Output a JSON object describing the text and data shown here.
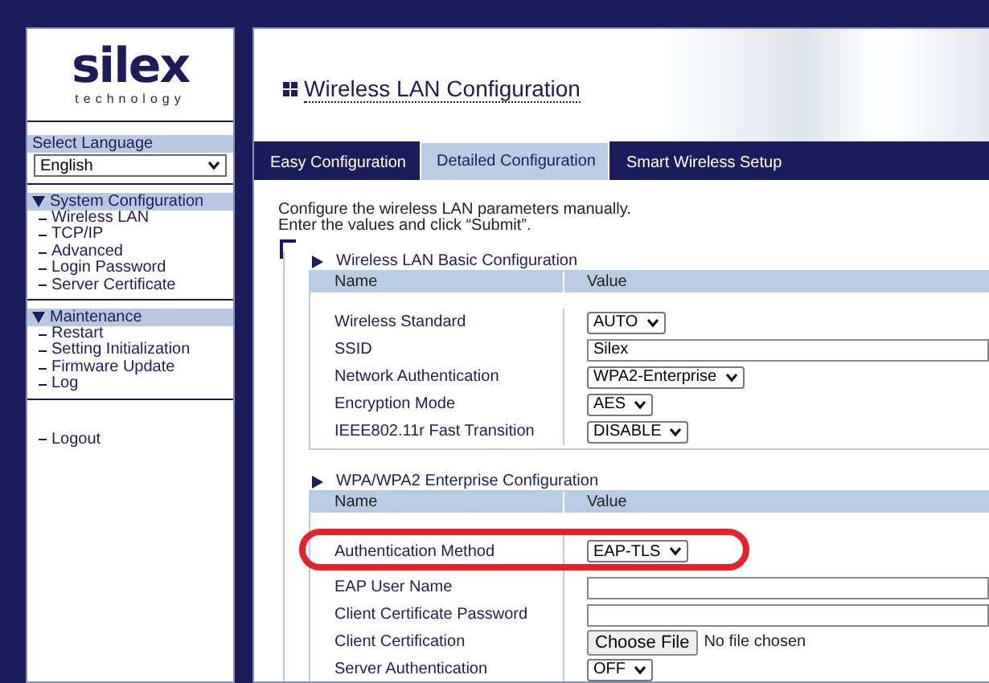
{
  "logo": {
    "name": "silex",
    "tagline": "technology"
  },
  "sidebar": {
    "language_label": "Select Language",
    "language": "English",
    "sections": [
      {
        "title": "System Configuration",
        "expanded": true,
        "items": [
          "Wireless LAN",
          "TCP/IP",
          "Advanced",
          "Login Password",
          "Server Certificate"
        ]
      },
      {
        "title": "Maintenance",
        "expanded": true,
        "items": [
          "Restart",
          "Setting Initialization",
          "Firmware Update",
          "Log"
        ]
      }
    ],
    "logout": "Logout"
  },
  "page_title": "Wireless LAN Configuration",
  "tabs": [
    {
      "label": "Easy Configuration",
      "selected": false
    },
    {
      "label": "Detailed Configuration",
      "selected": true
    },
    {
      "label": "Smart Wireless Setup",
      "selected": false
    }
  ],
  "intro": [
    "Configure the wireless LAN parameters manually.",
    "Enter the values and click “Submit”."
  ],
  "sections": [
    {
      "title": "Wireless LAN Basic Configuration",
      "columns": [
        "Name",
        "Value"
      ],
      "rows": [
        {
          "label": "Wireless Standard",
          "kind": "select",
          "value": "AUTO",
          "highlighted": false
        },
        {
          "label": "SSID",
          "kind": "text",
          "value": "Silex",
          "highlighted": false
        },
        {
          "label": "Network Authentication",
          "kind": "select",
          "value": "WPA2-Enterprise",
          "highlighted": false
        },
        {
          "label": "Encryption Mode",
          "kind": "select",
          "value": "AES",
          "highlighted": false
        },
        {
          "label": "IEEE802.11r Fast Transition",
          "kind": "select",
          "value": "DISABLE",
          "highlighted": false
        }
      ]
    },
    {
      "title": "WPA/WPA2 Enterprise Configuration",
      "columns": [
        "Name",
        "Value"
      ],
      "rows": [
        {
          "label": "Authentication Method",
          "kind": "select",
          "value": "EAP-TLS",
          "highlighted": true
        },
        {
          "label": "EAP User Name",
          "kind": "text",
          "highlighted": false
        },
        {
          "label": "Client Certificate Password",
          "kind": "text",
          "highlighted": false
        },
        {
          "label": "Client Certification",
          "kind": "file",
          "button": "Choose File",
          "value": "No file chosen",
          "highlighted": false
        },
        {
          "label": "Server Authentication",
          "kind": "select",
          "value": "OFF",
          "highlighted": false
        }
      ]
    }
  ]
}
